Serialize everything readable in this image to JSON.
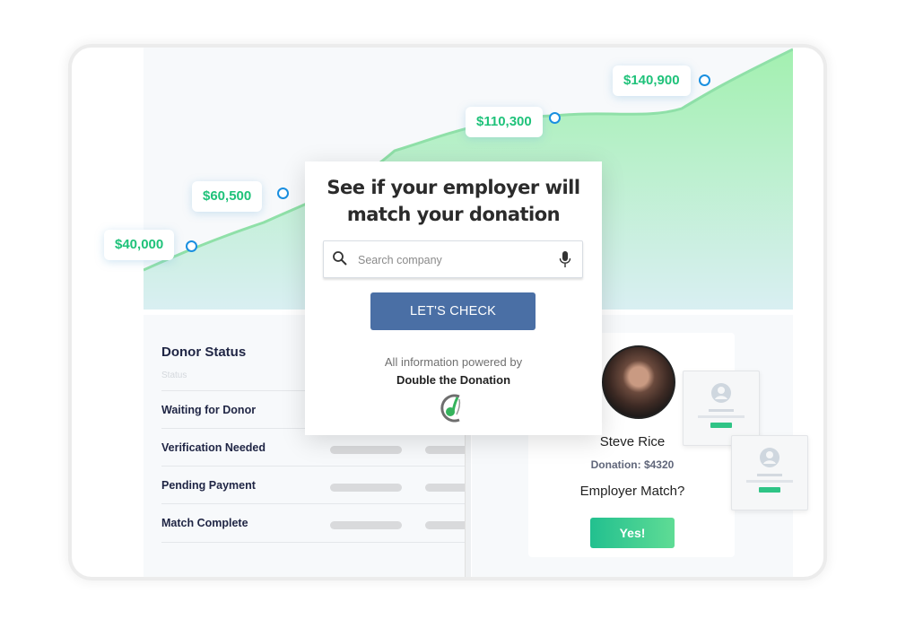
{
  "chart": {
    "points": [
      {
        "label": "$40,000",
        "value": 40000
      },
      {
        "label": "$60,500",
        "value": 60500
      },
      {
        "label": "$110,300",
        "value": 110300
      },
      {
        "label": "$140,900",
        "value": 140900
      }
    ],
    "colors": {
      "line": "#8fe0a8",
      "fill_top": "#a3f0b0",
      "fill_bottom": "#d9eff2",
      "dot": "#1a8fe0",
      "label": "#1fc27a"
    }
  },
  "modal": {
    "title_line1": "See if your employer will",
    "title_line2": "match your donation",
    "search_placeholder": "Search company",
    "search_icon": "search-icon",
    "mic_icon": "microphone-icon",
    "button_label": "LET'S CHECK",
    "powered_by": "All information powered by",
    "brand": "Double the Donation",
    "logo_icon": "double-the-donation-logo",
    "button_color": "#4a6fa5"
  },
  "donor_status": {
    "title": "Donor Status",
    "subtitle": "Status",
    "rows": [
      {
        "label": "Waiting for Donor"
      },
      {
        "label": "Verification Needed"
      },
      {
        "label": "Pending Payment"
      },
      {
        "label": "Match Complete"
      }
    ]
  },
  "donor_card": {
    "name": "Steve Rice",
    "donation": "Donation: $4320",
    "question": "Employer Match?",
    "button_label": "Yes!",
    "avatar_icon": "user-photo"
  }
}
